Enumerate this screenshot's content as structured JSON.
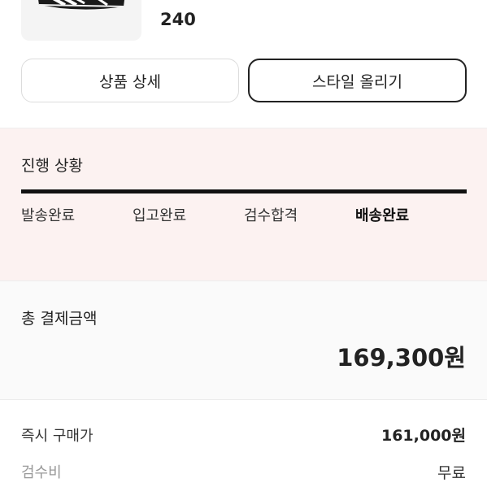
{
  "product": {
    "size": "240",
    "image_icon": "sneaker-thumbnail"
  },
  "buttons": {
    "detail": "상품 상세",
    "style": "스타일 올리기"
  },
  "progress": {
    "title": "진행 상황",
    "steps": [
      "발송완료",
      "입고완료",
      "검수합격",
      "배송완료"
    ],
    "active_step": "배송완료",
    "completion": 1.0
  },
  "payment": {
    "total_label": "총 결제금액",
    "total_amount": "169,300원",
    "rows": [
      {
        "label": "즉시 구매가",
        "value": "161,000원"
      },
      {
        "label": "검수비",
        "value": "무료"
      }
    ]
  },
  "colors": {
    "progress_bg": "#fcf2f1",
    "total_bg": "#fafafa",
    "accent": "#222222",
    "muted": "#999999"
  }
}
